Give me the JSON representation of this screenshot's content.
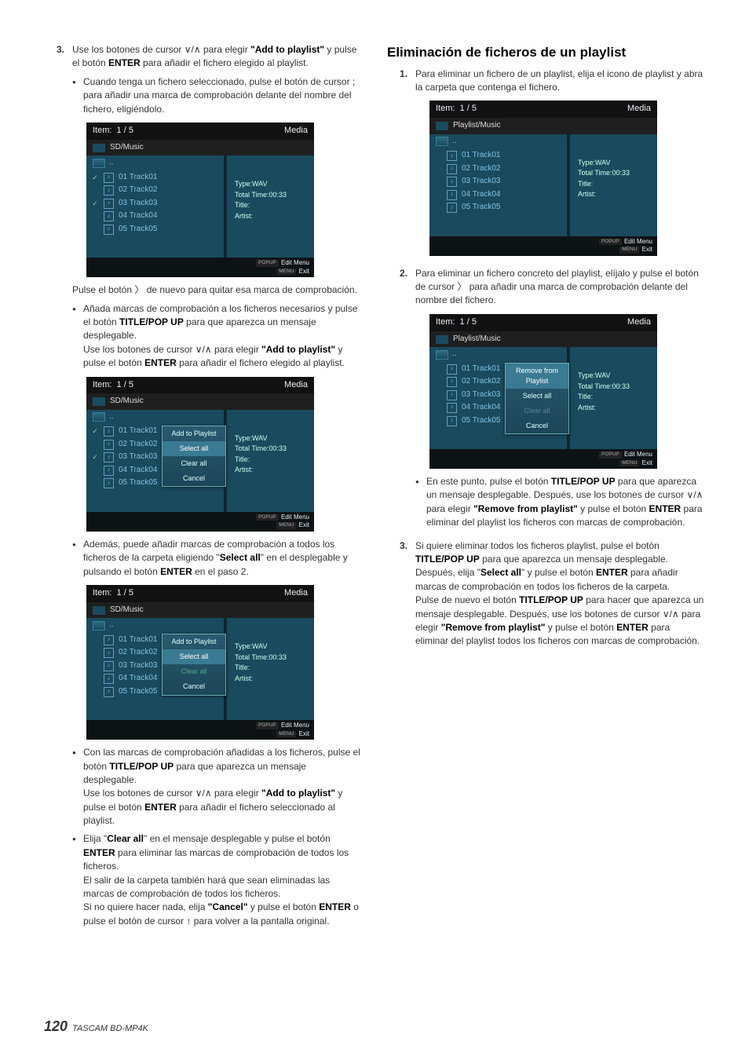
{
  "footer": {
    "page": "120",
    "model": "TASCAM BD-MP4K"
  },
  "left": {
    "step3": {
      "num": "3.",
      "p1a": "Use los botones de cursor ",
      "p1b": " para elegir ",
      "p1q": "\"Add to playlist\"",
      "p1c": " y pulse el botón ",
      "p1enter": "ENTER",
      "p1d": " para añadir el fichero elegido al playlist.",
      "b1": "Cuando tenga un fichero seleccionado, pulse el botón de cursor ; para añadir una marca de comprobación delante del nombre del fichero, eligiéndolo.",
      "afterSS1a": "Pulse el botón ",
      "afterSS1b": " de nuevo para quitar esa marca de comprobación.",
      "b2a": "Añada marcas de comprobación a los ficheros necesarios y pulse el botón ",
      "b2p": "TITLE/POP UP",
      "b2b": " para que aparezca un mensaje desplegable.",
      "b2c": "Use los botones de cursor ",
      "b2d": " para elegir ",
      "b2q": "\"Add to playlist\"",
      "b2e": " y pulse el botón ",
      "b2enter": "ENTER",
      "b2f": " para añadir el fichero elegido al playlist.",
      "b3a": "Además, puede añadir marcas de comprobación a todos los ficheros de la carpeta eligiendo \"",
      "b3s": "Select all",
      "b3b": "\" en el desplegable y pulsando el botón ",
      "b3enter": "ENTER",
      "b3c": " en el paso 2.",
      "b4a": "Con las marcas de comprobación añadidas a los ficheros, pulse el botón ",
      "b4p": "TITLE/POP UP",
      "b4b": " para que aparezca un mensaje desplegable.",
      "b4c": "Use los botones de cursor ",
      "b4d": " para elegir ",
      "b4q": "\"Add to playlist\"",
      "b4e": " y pulse el botón ",
      "b4enter": "ENTER",
      "b4f": " para añadir el fichero seleccionado al playlist.",
      "b5a": "Elija \"",
      "b5c": "Clear all",
      "b5b": "\" en el mensaje desplegable y pulse el botón ",
      "b5enter": "ENTER",
      "b5d": " para eliminar las marcas de comprobación de todos los ficheros.",
      "b5e": "El salir de la carpeta también hará que sean eliminadas las marcas de comprobación de todos los ficheros.",
      "b5f": "Si no quiere hacer nada, elija ",
      "b5q": "\"Cancel\"",
      "b5g": " y pulse el botón ",
      "b5enter2": "ENTER",
      "b5h": " o pulse el botón de cursor ",
      "b5i": " para volver a la pantalla original."
    }
  },
  "right": {
    "heading": "Eliminación de ficheros de un playlist",
    "s1": {
      "num": "1.",
      "t": "Para eliminar un fichero de un playlist, elija el icono de playlist y abra la carpeta que contenga el fichero."
    },
    "s2": {
      "num": "2.",
      "a": "Para eliminar un fichero concreto del playlist, elíjalo y pulse el botón de cursor ",
      "b": " para añadir una marca de comprobación delante del nombre del fichero.",
      "bu1a": "En este punto, pulse el botón ",
      "bu1p": "TITLE/POP UP",
      "bu1b": " para que aparezca un mensaje desplegable. Después, use los botones de cursor ",
      "bu1c": " para elegir ",
      "bu1q": "\"Remove from playlist\"",
      "bu1d": " y pulse el botón ",
      "bu1enter": "ENTER",
      "bu1e": " para eliminar del playlist los ficheros con marcas de comprobación."
    },
    "s3": {
      "num": "3.",
      "a": "Si quiere eliminar todos los ficheros playlist, pulse el botón ",
      "p": "TITLE/POP UP",
      "b": " para que aparezca un mensaje desplegable. Después, elija \"",
      "s": "Select all",
      "c": "\" y pulse el botón ",
      "enter": "ENTER",
      "d": " para añadir marcas de comprobación en todos los ficheros de la carpeta.",
      "e": "Pulse de nuevo el botón ",
      "p2": "TITLE/POP UP",
      "f": " para hacer que aparezca un mensaje desplegable. Después, use los botones de cursor ",
      "g": " para elegir ",
      "q": "\"Remove from playlist\"",
      "h": " y pulse el botón ",
      "enter2": "ENTER",
      "i": " para eliminar del playlist todos los ficheros con marcas de comprobación."
    }
  },
  "ss": {
    "item": "Item:",
    "count": "1 / 5",
    "media": "Media",
    "sd": "SD/Music",
    "pl": "Playlist/Music",
    "tracks": [
      "01 Track01",
      "02 Track02",
      "03 Track03",
      "04 Track04",
      "05 Track05"
    ],
    "info": {
      "type": "Type:WAV",
      "time": "Total Time:00:33",
      "title": "Title:",
      "artist": "Artist:"
    },
    "foot": {
      "popup": "POPUP",
      "edit": "Edit Menu",
      "menu": "MENU",
      "exit": "Exit"
    },
    "popup_add": {
      "r1": "Add to Playlist",
      "r2": "Select all",
      "r3": "Clear all",
      "r4": "Cancel"
    },
    "popup_rem": {
      "r1": "Remove from Playlist",
      "r2": "Select all",
      "r3": "Clear all",
      "r4": "Cancel"
    }
  }
}
